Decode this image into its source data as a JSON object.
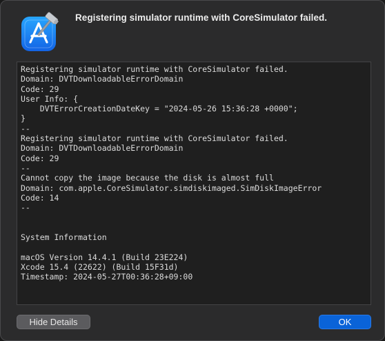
{
  "window": {
    "title": "Registering simulator runtime with CoreSimulator failed."
  },
  "app_icon": {
    "name": "xcode-app-icon",
    "accent_color": "#1e8cf5"
  },
  "details": {
    "text": "Registering simulator runtime with CoreSimulator failed.\nDomain: DVTDownloadableErrorDomain\nCode: 29\nUser Info: {\n    DVTErrorCreationDateKey = \"2024-05-26 15:36:28 +0000\";\n}\n--\nRegistering simulator runtime with CoreSimulator failed.\nDomain: DVTDownloadableErrorDomain\nCode: 29\n--\nCannot copy the image because the disk is almost full\nDomain: com.apple.CoreSimulator.simdiskimaged.SimDiskImageError\nCode: 14\n--\n\n\nSystem Information\n\nmacOS Version 14.4.1 (Build 23E224)\nXcode 15.4 (22622) (Build 15F31d)\nTimestamp: 2024-05-27T00:36:28+09:00"
  },
  "buttons": {
    "hide_details": "Hide Details",
    "ok": "OK"
  },
  "colors": {
    "dialog_background": "#2b2b2c",
    "primary_button": "#0a63d8",
    "secondary_button": "#5b5b5e"
  }
}
